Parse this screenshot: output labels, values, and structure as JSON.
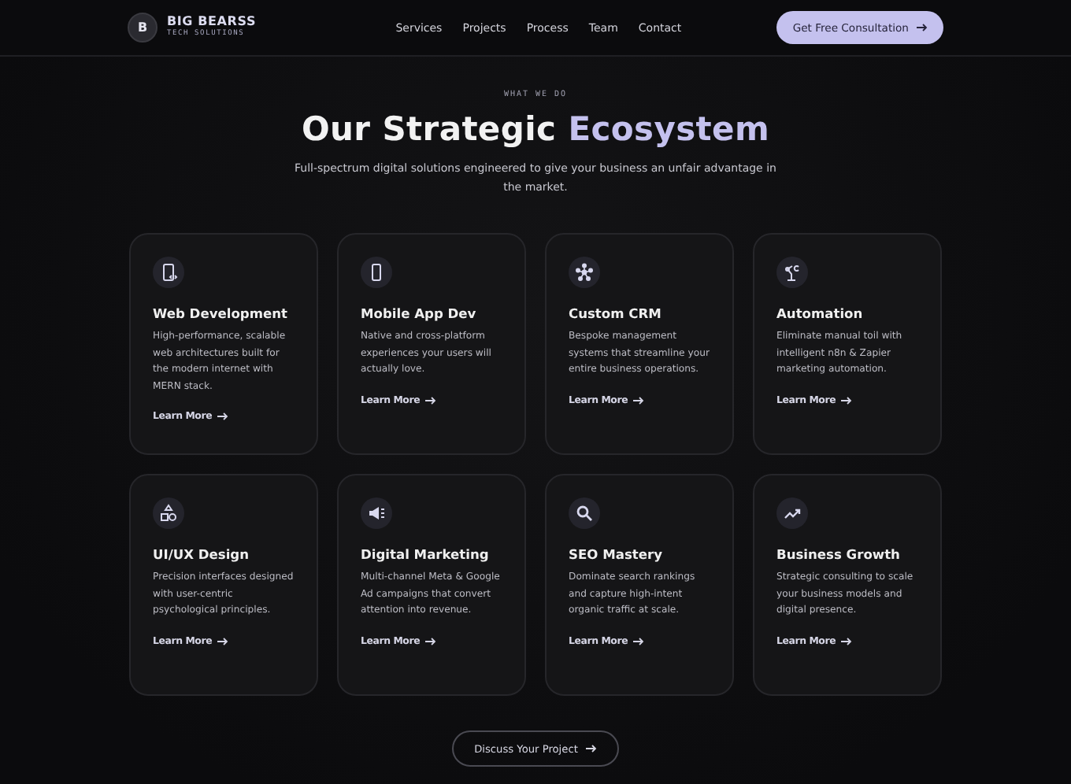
{
  "header": {
    "logo_mark": "B",
    "brand": "BIG BEARSS",
    "tagline": "TECH SOLUTIONS",
    "nav": [
      "Services",
      "Projects",
      "Process",
      "Team",
      "Contact"
    ],
    "cta": "Get Free Consultation"
  },
  "section": {
    "eyebrow": "WHAT WE DO",
    "title": "Our Strategic",
    "title_highlight": "Ecosystem",
    "subtitle": "Full-spectrum digital solutions engineered to give your business an unfair advantage in the market."
  },
  "services": [
    {
      "title": "Web Development",
      "description": "High-performance, scalable web architectures built for the modern internet with MERN stack.",
      "link": "Learn More"
    },
    {
      "title": "Mobile App Dev",
      "description": "Native and cross-platform experiences your users will actually love.",
      "link": "Learn More"
    },
    {
      "title": "Custom CRM",
      "description": "Bespoke management systems that streamline your entire business operations.",
      "link": "Learn More"
    },
    {
      "title": "Automation",
      "description": "Eliminate manual toil with intelligent n8n & Zapier marketing automation.",
      "link": "Learn More"
    },
    {
      "title": "UI/UX Design",
      "description": "Precision interfaces designed with user-centric psychological principles.",
      "link": "Learn More"
    },
    {
      "title": "Digital Marketing",
      "description": "Multi-channel Meta & Google Ad campaigns that convert attention into revenue.",
      "link": "Learn More"
    },
    {
      "title": "SEO Mastery",
      "description": "Dominate search rankings and capture high-intent organic traffic at scale.",
      "link": "Learn More"
    },
    {
      "title": "Business Growth",
      "description": "Strategic consulting to scale your business models and digital presence.",
      "link": "Learn More"
    }
  ],
  "footer_cta": "Discuss Your Project"
}
